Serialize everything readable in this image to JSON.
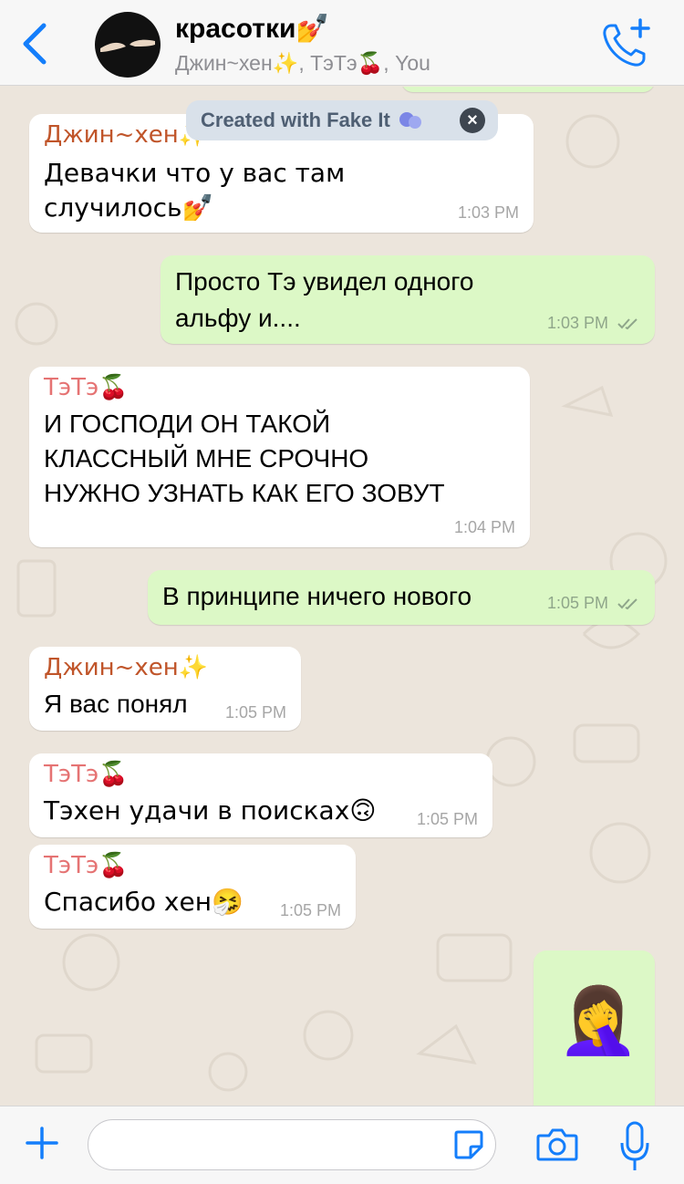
{
  "header": {
    "title": "красотки💅",
    "subtitle": "Джин~хен✨, ТэТэ🍒, You"
  },
  "watermark": {
    "text": "Created with Fake It"
  },
  "messages": [
    {
      "sender": "Джин~хен✨",
      "sender_color": "#c0552a",
      "text_line1": "Девачки что у вас там",
      "text_line2": "случилось💅",
      "time": "1:03 PM"
    },
    {
      "text_line1": "Просто Тэ увидел одного",
      "text_line2": "альфу и....",
      "time": "1:03 PM"
    },
    {
      "sender": "ТэТэ🍒",
      "sender_color": "#e57373",
      "text_line1": "И ГОСПОДИ ОН ТАКОЙ",
      "text_line2": "КЛАССНЫЙ МНЕ СРОЧНО",
      "text_line3": "НУЖНО УЗНАТЬ КАК ЕГО ЗОВУТ",
      "time": "1:04 PM"
    },
    {
      "text_line1": "В принципе ничего нового",
      "time": "1:05 PM"
    },
    {
      "sender": "Джин~хен✨",
      "sender_color": "#c0552a",
      "text_line1": "Я вас понял",
      "time": "1:05 PM"
    },
    {
      "sender": "ТэТэ🍒",
      "sender_color": "#e57373",
      "text_line1": "Тэхен удачи в поисках🙃",
      "time": "1:05 PM"
    },
    {
      "sender": "ТэТэ🍒",
      "sender_color": "#e57373",
      "text_line1": "Спасибо хен🤧",
      "time": "1:05 PM"
    },
    {
      "emoji": "🤦‍♀️"
    }
  ],
  "input": {
    "placeholder": ""
  },
  "colors": {
    "accent": "#147efb",
    "incoming": "#ffffff",
    "outgoing": "#dcf8c6",
    "background": "#ece5dc"
  }
}
